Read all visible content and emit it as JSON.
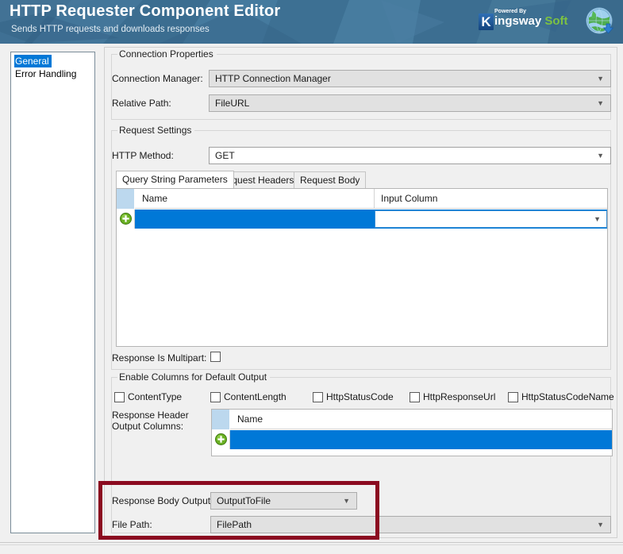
{
  "header": {
    "title": "HTTP Requester Component Editor",
    "subtitle": "Sends HTTP requests and downloads responses",
    "logo": {
      "badge": "K",
      "powered_by": "Powered By",
      "brand_first": "ingsway",
      "brand_second": "Soft",
      "globe_icon": "globe-download-icon"
    },
    "colors": {
      "banner": "#3a6b8c",
      "brand_green": "#7dc242",
      "brand_blue": "#14447d"
    }
  },
  "sidebar": {
    "items": [
      {
        "label": "General",
        "selected": true
      },
      {
        "label": "Error Handling",
        "selected": false
      }
    ]
  },
  "connection_properties": {
    "legend": "Connection Properties",
    "connection_manager": {
      "label": "Connection Manager:",
      "value": "HTTP Connection Manager"
    },
    "relative_path": {
      "label": "Relative Path:",
      "value": "FileURL"
    }
  },
  "request_settings": {
    "legend": "Request Settings",
    "http_method": {
      "label": "HTTP Method:",
      "value": "GET"
    },
    "tabs": [
      {
        "label": "Query String Parameters",
        "active": true
      },
      {
        "label": "Request Headers",
        "active": false
      },
      {
        "label": "Request Body",
        "active": false
      }
    ],
    "grid": {
      "columns": [
        "Name",
        "Input Column"
      ],
      "rows": [],
      "new_row_icon": "add-row-icon",
      "new_row_name_value": "",
      "new_row_input_column_value": ""
    },
    "response_is_multipart": {
      "label": "Response Is Multipart:",
      "checked": false
    }
  },
  "enable_columns": {
    "legend": "Enable Columns for Default Output",
    "checkboxes": [
      {
        "label": "ContentType",
        "checked": false
      },
      {
        "label": "ContentLength",
        "checked": false
      },
      {
        "label": "HttpStatusCode",
        "checked": false
      },
      {
        "label": "HttpResponseUrl",
        "checked": false
      },
      {
        "label": "HttpStatusCodeName",
        "checked": false
      }
    ],
    "response_header_output_columns": {
      "label_line1": "Response Header",
      "label_line2": "Output Columns:",
      "columns": [
        "Name"
      ],
      "rows": [],
      "new_row_icon": "add-row-icon"
    },
    "response_body_output": {
      "label": "Response Body Output:",
      "value": "OutputToFile"
    },
    "file_path": {
      "label": "File Path:",
      "value": "FilePath"
    },
    "highlight_color": "#8b0a20"
  }
}
